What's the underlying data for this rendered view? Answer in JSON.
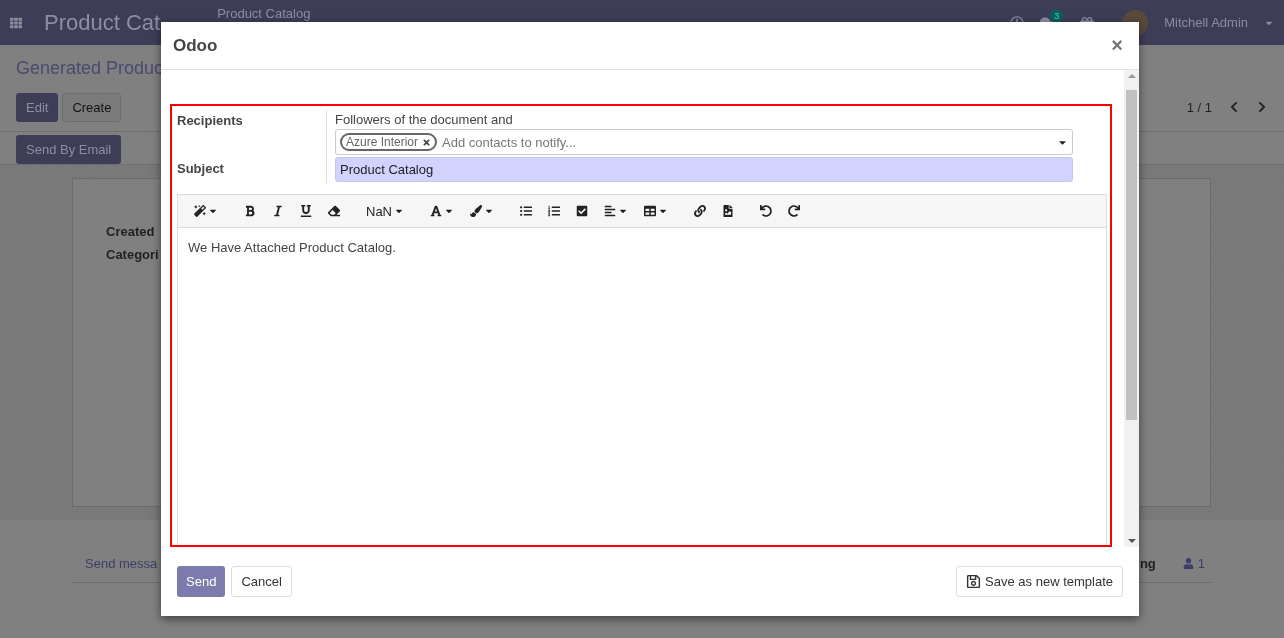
{
  "navbar": {
    "app_title": "Product Cat",
    "breadcrumb": "Product Catalog",
    "message_count": "3",
    "user_name": "Mitchell Admin"
  },
  "control_panel": {
    "title": "Generated Produc",
    "edit_button": "Edit",
    "create_button": "Create",
    "pager": "1 / 1",
    "action_button": "Send By Email"
  },
  "sheet": {
    "fields": [
      "Created",
      "Categori"
    ]
  },
  "chatter": {
    "send_message": "Send messa",
    "following": "ng",
    "followers_count": "1"
  },
  "dialog": {
    "title": "Odoo",
    "close": "×",
    "recipients_label": "Recipients",
    "followers_text": "Followers of the document and",
    "tags": [
      {
        "label": "Azure Interior"
      }
    ],
    "contacts_placeholder": "Add contacts to notify...",
    "subject_label": "Subject",
    "subject_value": "Product Catalog",
    "font_size": "NaN",
    "body": "We Have Attached Product Catalog.",
    "send_button": "Send",
    "cancel_button": "Cancel",
    "template_button": "Save as new template"
  }
}
